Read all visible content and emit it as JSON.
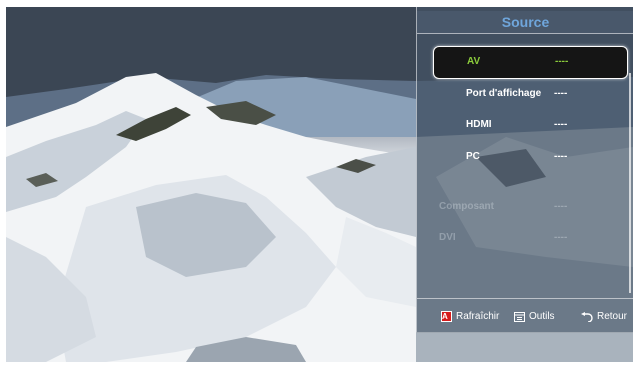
{
  "menu": {
    "title": "Source",
    "items": [
      {
        "label": "AV",
        "value": "----",
        "state": "selected"
      },
      {
        "label": "Port d'affichage",
        "value": "----",
        "state": "normal"
      },
      {
        "label": "HDMI",
        "value": "----",
        "state": "normal"
      },
      {
        "label": "PC",
        "value": "----",
        "state": "normal"
      },
      {
        "label": "Composant",
        "value": "----",
        "state": "disabled"
      },
      {
        "label": "DVI",
        "value": "----",
        "state": "disabled"
      }
    ]
  },
  "footer": {
    "refresh_label": "Rafraîchir",
    "refresh_key": "A",
    "tools_label": "Outils",
    "return_label": "Retour"
  },
  "colors": {
    "title": "#6fa6dc",
    "selected_text": "#8ccc3c",
    "key_red": "#d61e1e"
  }
}
